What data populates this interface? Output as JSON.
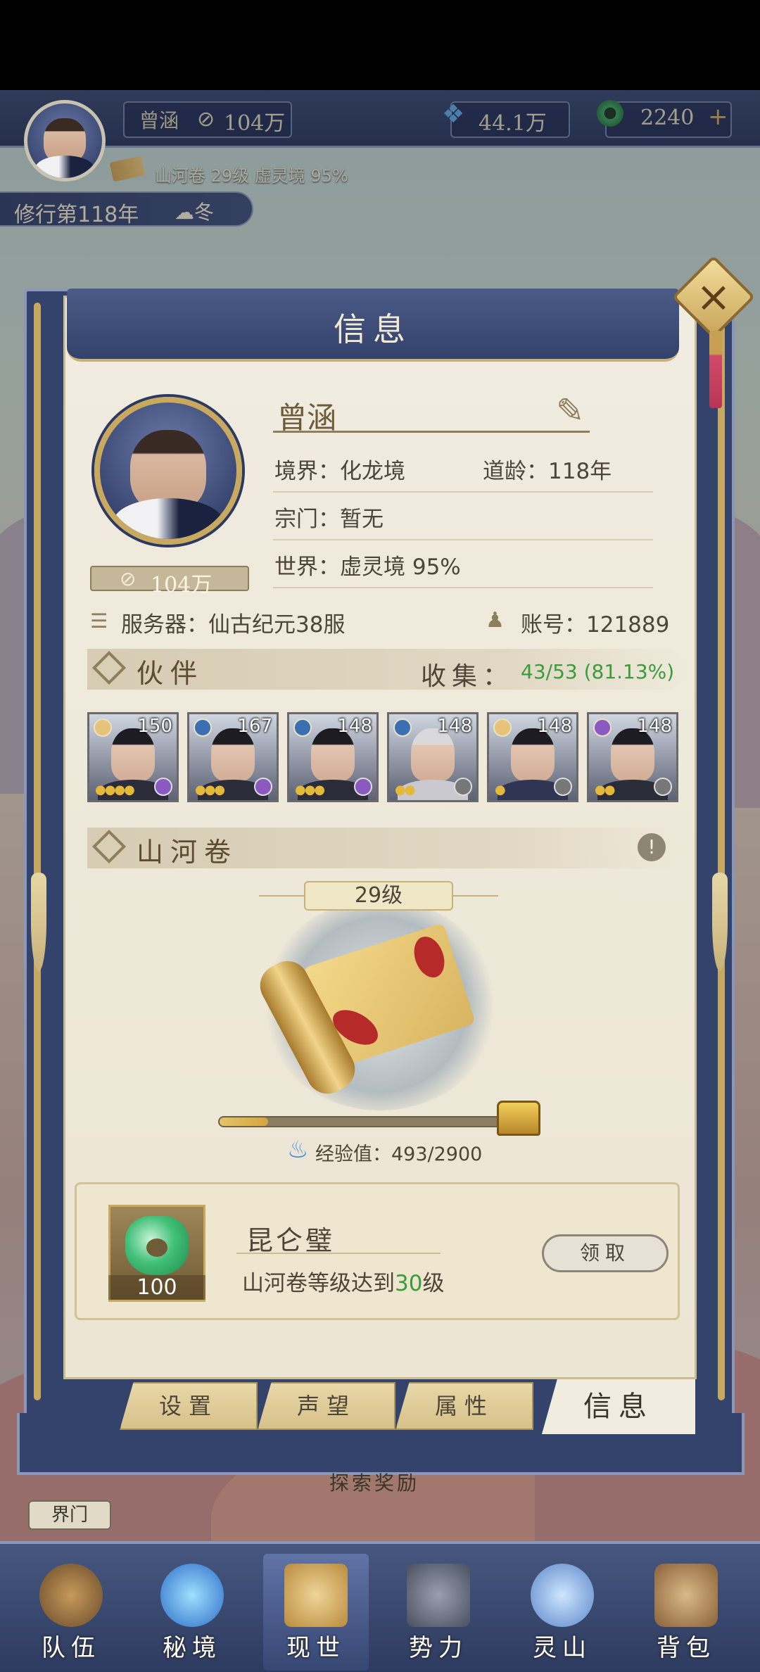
{
  "hud": {
    "player_name": "曾涵",
    "power": "104万",
    "jade": "44.1万",
    "coins": "2240",
    "coin_plus": "+",
    "scroll_status": "山河卷 29级 虚灵境 95%",
    "cultivation_year": "修行第118年",
    "season": "冬"
  },
  "modal": {
    "title": "信息",
    "close": "×",
    "profile": {
      "name": "曾涵",
      "power": "104万",
      "realm": "境界：化龙境",
      "age": "道龄：118年",
      "sect": "宗门：暂无",
      "world": "世界：虚灵境 95%",
      "server": "服务器：仙古纪元38服",
      "account": "账号：121889"
    },
    "partners": {
      "title": "伙伴",
      "collect_label": "收集：",
      "collect_value": "43/53 (81.13%)",
      "list": [
        {
          "level": "150"
        },
        {
          "level": "167"
        },
        {
          "level": "148"
        },
        {
          "level": "148"
        },
        {
          "level": "148"
        },
        {
          "level": "148"
        }
      ]
    },
    "scroll": {
      "title": "山河卷",
      "info": "!",
      "level": "29级",
      "exp_text": "经验值：493/2900",
      "exp_current": 493,
      "exp_max": 2900
    },
    "reward": {
      "name": "昆仑璧",
      "quantity": "100",
      "desc_prefix": "山河卷等级达到",
      "desc_num": "30",
      "desc_suffix": "级",
      "claim": "领取"
    },
    "tabs": [
      "设置",
      "声望",
      "属性",
      "信息"
    ]
  },
  "map": {
    "explore_reward": "探索奖励",
    "realm_gate": "界门"
  },
  "nav": [
    "队伍",
    "秘境",
    "现世",
    "势力",
    "灵山",
    "背包"
  ],
  "colors": {
    "accent_green": "#3b9c3b",
    "panel_blue": "#34436b",
    "paper": "#f1ece0",
    "gold": "#c9a860"
  }
}
